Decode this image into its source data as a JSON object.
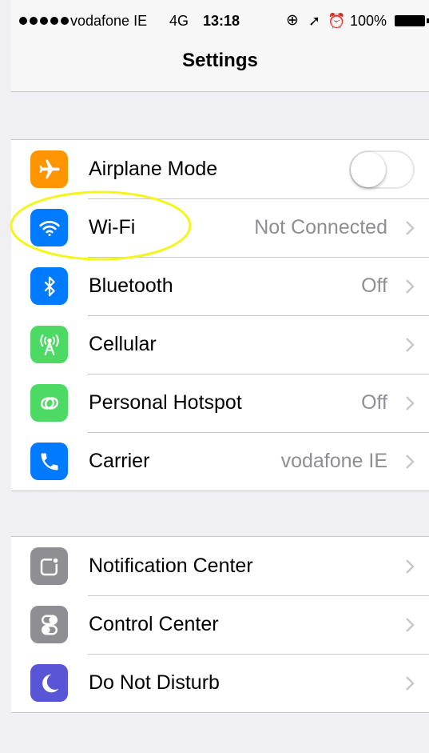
{
  "status_bar": {
    "carrier": "vodafone IE",
    "network": "4G",
    "time": "13:18",
    "battery": "100%"
  },
  "nav": {
    "title": "Settings"
  },
  "group1": [
    {
      "label": "Airplane Mode",
      "icon": "airplane-icon",
      "color": "#ff9500",
      "toggle": false
    },
    {
      "label": "Wi-Fi",
      "icon": "wifi-icon",
      "color": "#007aff",
      "detail": "Not Connected"
    },
    {
      "label": "Bluetooth",
      "icon": "bluetooth-icon",
      "color": "#007aff",
      "detail": "Off"
    },
    {
      "label": "Cellular",
      "icon": "cellular-antenna-icon",
      "color": "#4cd964",
      "detail": ""
    },
    {
      "label": "Personal Hotspot",
      "icon": "hotspot-link-icon",
      "color": "#4cd964",
      "detail": "Off"
    },
    {
      "label": "Carrier",
      "icon": "phone-icon",
      "color": "#007aff",
      "detail": "vodafone IE"
    }
  ],
  "group2": [
    {
      "label": "Notification Center",
      "icon": "notification-center-icon",
      "color": "#8e8e93",
      "detail": ""
    },
    {
      "label": "Control Center",
      "icon": "control-center-icon",
      "color": "#8e8e93",
      "detail": ""
    },
    {
      "label": "Do Not Disturb",
      "icon": "moon-icon",
      "color": "#5856d6",
      "detail": ""
    }
  ],
  "annotation": {
    "highlight_color": "#f5f51e",
    "target": "Wi-Fi"
  }
}
